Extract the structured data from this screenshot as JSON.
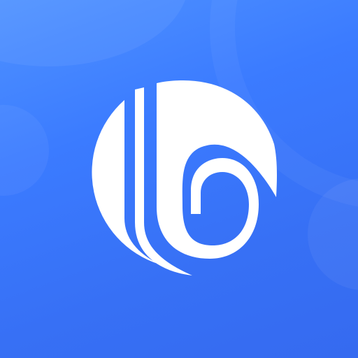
{
  "app_icon": {
    "logo_icon": "stylized-b-circle-logo-icon",
    "colors": {
      "background_top": "#4f92ff",
      "background_bottom": "#356af0",
      "logo": "#ffffff"
    }
  }
}
